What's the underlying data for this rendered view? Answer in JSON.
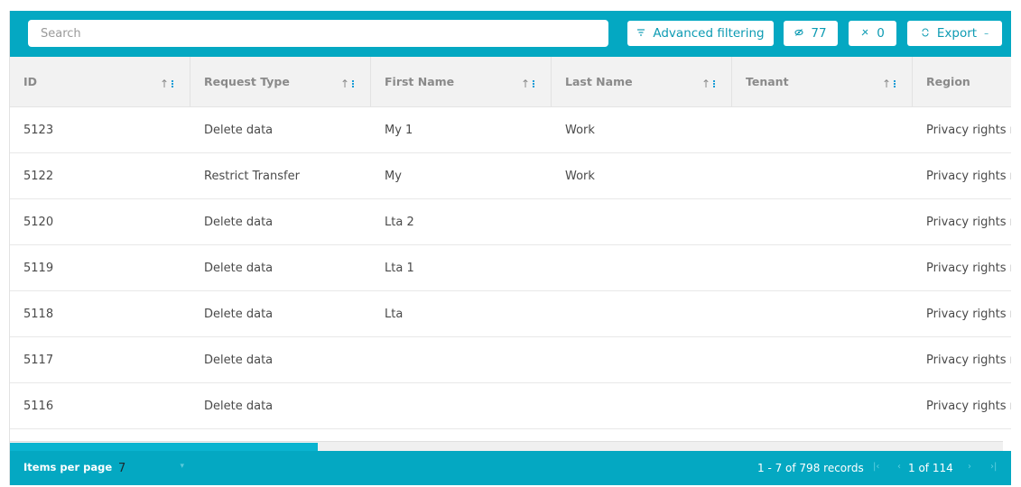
{
  "toolbar": {
    "search_placeholder": "Search",
    "advanced_filtering_label": "Advanced filtering",
    "hidden_count": "77",
    "pinned_count": "0",
    "export_label": "Export",
    "accent_color": "#04a8c2",
    "icons": {
      "advanced_filtering": "filter-icon",
      "hidden": "eye-off-icon",
      "pinned": "pin-icon",
      "export": "refresh-icon",
      "export_caret": "caret-down-icon"
    }
  },
  "table": {
    "columns": [
      {
        "label": "ID"
      },
      {
        "label": "Request Type"
      },
      {
        "label": "First Name"
      },
      {
        "label": "Last Name"
      },
      {
        "label": "Tenant"
      },
      {
        "label": "Region"
      }
    ],
    "rows": [
      {
        "id": "5123",
        "request_type": "Delete data",
        "first_name": "My 1",
        "last_name": "Work",
        "tenant": "",
        "region": "Privacy rights r"
      },
      {
        "id": "5122",
        "request_type": "Restrict Transfer",
        "first_name": "My",
        "last_name": "Work",
        "tenant": "",
        "region": "Privacy rights r"
      },
      {
        "id": "5120",
        "request_type": "Delete data",
        "first_name": "Lta 2",
        "last_name": "",
        "tenant": "",
        "region": "Privacy rights r"
      },
      {
        "id": "5119",
        "request_type": "Delete data",
        "first_name": "Lta 1",
        "last_name": "",
        "tenant": "",
        "region": "Privacy rights r"
      },
      {
        "id": "5118",
        "request_type": "Delete data",
        "first_name": "Lta",
        "last_name": "",
        "tenant": "",
        "region": "Privacy rights r"
      },
      {
        "id": "5117",
        "request_type": "Delete data",
        "first_name": "",
        "last_name": "",
        "tenant": "",
        "region": "Privacy rights r"
      },
      {
        "id": "5116",
        "request_type": "Delete data",
        "first_name": "",
        "last_name": "",
        "tenant": "",
        "region": "Privacy rights r"
      }
    ],
    "horizontal_scroll_fraction": 0.31
  },
  "footer": {
    "items_per_page_label": "Items per page",
    "items_per_page_value": "7",
    "records_text": "1 - 7 of 798 records",
    "page_text": "1 of 114",
    "icons": [
      "first-page-icon",
      "prev-page-icon",
      "next-page-icon",
      "last-page-icon"
    ]
  }
}
